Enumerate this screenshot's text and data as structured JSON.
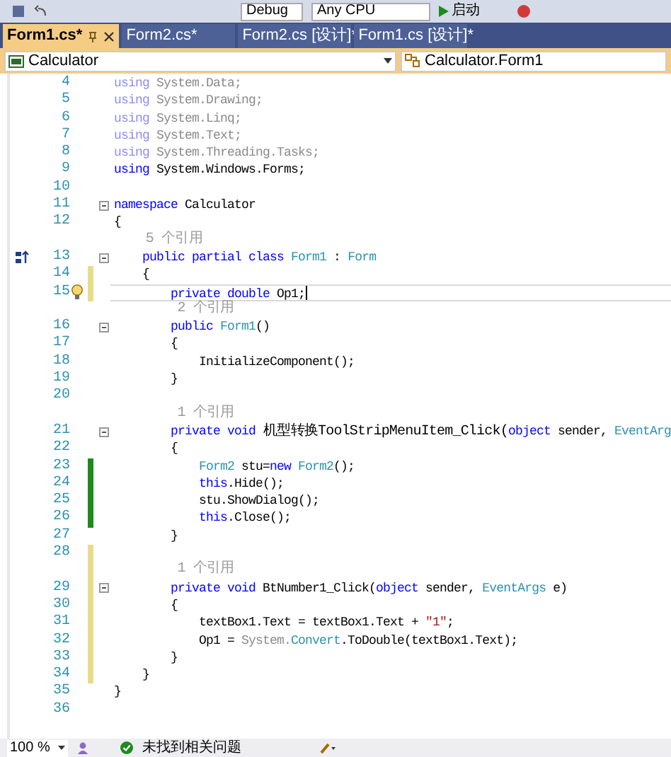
{
  "toolbar": {
    "configuration": "Debug",
    "platform": "Any CPU",
    "start": "启动"
  },
  "tabs": [
    {
      "label": "Form1.cs*",
      "selected": true,
      "pinned": true
    },
    {
      "label": "Form2.cs*",
      "selected": false,
      "pinned": false
    },
    {
      "label": "Form2.cs [设计]*",
      "selected": false,
      "pinned": false
    },
    {
      "label": "Form1.cs [设计]*",
      "selected": false,
      "pinned": false
    }
  ],
  "navigation": {
    "project": "Calculator",
    "type": "Calculator.Form1"
  },
  "rows": [
    {
      "kind": "code",
      "number": "4",
      "current": false,
      "fold": false,
      "tokens": [
        {
          "t": "using",
          "color": "#8c8cf0"
        },
        {
          "t": " System.Data;",
          "color": "#8a8a8a"
        }
      ]
    },
    {
      "kind": "code",
      "number": "5",
      "current": false,
      "fold": false,
      "tokens": [
        {
          "t": "using",
          "color": "#8c8cf0"
        },
        {
          "t": " System.Drawing;",
          "color": "#8a8a8a"
        }
      ]
    },
    {
      "kind": "code",
      "number": "6",
      "current": false,
      "fold": false,
      "tokens": [
        {
          "t": "using",
          "color": "#8c8cf0"
        },
        {
          "t": " System.Linq;",
          "color": "#8a8a8a"
        }
      ]
    },
    {
      "kind": "code",
      "number": "7",
      "current": false,
      "fold": false,
      "tokens": [
        {
          "t": "using",
          "color": "#8c8cf0"
        },
        {
          "t": " System.Text;",
          "color": "#8a8a8a"
        }
      ]
    },
    {
      "kind": "code",
      "number": "8",
      "current": false,
      "fold": false,
      "tokens": [
        {
          "t": "using",
          "color": "#8c8cf0"
        },
        {
          "t": " System.Threading.Tasks;",
          "color": "#8a8a8a"
        }
      ]
    },
    {
      "kind": "code",
      "number": "9",
      "current": false,
      "fold": false,
      "tokens": [
        {
          "t": "using",
          "color": "#0000ff"
        },
        {
          "t": " System.Windows.Forms;",
          "color": "#000000"
        }
      ]
    },
    {
      "kind": "code",
      "number": "10",
      "current": false,
      "fold": false
    },
    {
      "kind": "code",
      "number": "11",
      "current": false,
      "fold": true,
      "tokens": [
        {
          "t": "namespace",
          "color": "#0000ff"
        },
        {
          "t": " Calculator",
          "color": "#000000"
        }
      ]
    },
    {
      "kind": "code",
      "number": "12",
      "current": false,
      "fold": false,
      "tokens": [
        {
          "t": "{",
          "color": "#000000"
        }
      ]
    },
    {
      "kind": "codelens",
      "text": "    5 个引用"
    },
    {
      "kind": "code",
      "number": "13",
      "current": false,
      "fold": true,
      "inheritance": true,
      "tokens": [
        {
          "t": "    public",
          "color": "#0000ff"
        },
        {
          "t": " partial",
          "color": "#0000ff"
        },
        {
          "t": " class",
          "color": "#0000ff"
        },
        {
          "t": " Form1",
          "color": "#2b91af"
        },
        {
          "t": " :",
          "color": "#000000"
        },
        {
          "t": " Form",
          "color": "#2b91af"
        }
      ]
    },
    {
      "kind": "code",
      "number": "14",
      "color": "#e8dc8c",
      "current": false,
      "fold": false,
      "tokens": [
        {
          "t": "    {",
          "color": "#000000"
        }
      ]
    },
    {
      "kind": "code",
      "number": "15",
      "color": "#e8dc8c",
      "current": true,
      "fold": false,
      "lightbulb": true,
      "tokens": [
        {
          "t": "        private",
          "color": "#0000ff"
        },
        {
          "t": " double",
          "color": "#0000ff"
        },
        {
          "t": " Op1;",
          "color": "#000000"
        }
      ]
    },
    {
      "kind": "codelens",
      "text": "        2 个引用"
    },
    {
      "kind": "code",
      "number": "16",
      "current": false,
      "fold": true,
      "tokens": [
        {
          "t": "        public",
          "color": "#0000ff"
        },
        {
          "t": " Form1",
          "color": "#2b91af"
        },
        {
          "t": "()",
          "color": "#000000"
        }
      ]
    },
    {
      "kind": "code",
      "number": "17",
      "current": false,
      "fold": false,
      "tokens": [
        {
          "t": "        {",
          "color": "#000000"
        }
      ]
    },
    {
      "kind": "code",
      "number": "18",
      "current": false,
      "fold": false,
      "tokens": [
        {
          "t": "            InitializeComponent();",
          "color": "#000000"
        }
      ]
    },
    {
      "kind": "code",
      "number": "19",
      "current": false,
      "fold": false,
      "tokens": [
        {
          "t": "        }",
          "color": "#000000"
        }
      ]
    },
    {
      "kind": "code",
      "number": "20",
      "current": false,
      "fold": false
    },
    {
      "kind": "codelens",
      "text": "        1 个引用"
    },
    {
      "kind": "code",
      "number": "21",
      "current": false,
      "fold": true,
      "tokens": [
        {
          "t": "        private",
          "color": "#0000ff"
        },
        {
          "t": " void",
          "color": "#0000ff"
        },
        {
          "t": " 机型转换ToolStripMenuItem_Click(",
          "color": "#000000"
        },
        {
          "t": "object",
          "color": "#0000ff"
        },
        {
          "t": " sender,",
          "color": "#000000"
        },
        {
          "t": " EventArg",
          "color": "#2b91af"
        }
      ]
    },
    {
      "kind": "code",
      "number": "22",
      "current": false,
      "fold": false,
      "tokens": [
        {
          "t": "        {",
          "color": "#000000"
        }
      ]
    },
    {
      "kind": "code",
      "number": "23",
      "color": "#1e8a1e",
      "current": false,
      "fold": false,
      "tokens": [
        {
          "t": "            Form2",
          "color": "#2b91af"
        },
        {
          "t": " stu=",
          "color": "#000000"
        },
        {
          "t": "new",
          "color": "#0000ff"
        },
        {
          "t": " Form2",
          "color": "#2b91af"
        },
        {
          "t": "();",
          "color": "#000000"
        }
      ]
    },
    {
      "kind": "code",
      "number": "24",
      "color": "#1e8a1e",
      "current": false,
      "fold": false,
      "tokens": [
        {
          "t": "            this",
          "color": "#0000ff"
        },
        {
          "t": ".Hide();",
          "color": "#000000"
        }
      ]
    },
    {
      "kind": "code",
      "number": "25",
      "color": "#1e8a1e",
      "current": false,
      "fold": false,
      "tokens": [
        {
          "t": "            stu.ShowDialog();",
          "color": "#000000"
        }
      ]
    },
    {
      "kind": "code",
      "number": "26",
      "color": "#1e8a1e",
      "current": false,
      "fold": false,
      "tokens": [
        {
          "t": "            this",
          "color": "#0000ff"
        },
        {
          "t": ".Close();",
          "color": "#000000"
        }
      ]
    },
    {
      "kind": "code",
      "number": "27",
      "current": false,
      "fold": false,
      "tokens": [
        {
          "t": "        }",
          "color": "#000000"
        }
      ]
    },
    {
      "kind": "code",
      "number": "28",
      "color": "#e8dc8c",
      "current": false,
      "fold": false
    },
    {
      "kind": "codelens",
      "color": "#e8dc8c",
      "text": "        1 个引用"
    },
    {
      "kind": "code",
      "number": "29",
      "color": "#e8dc8c",
      "current": false,
      "fold": true,
      "tokens": [
        {
          "t": "        private",
          "color": "#0000ff"
        },
        {
          "t": " void",
          "color": "#0000ff"
        },
        {
          "t": " BtNumber1_Click(",
          "color": "#000000"
        },
        {
          "t": "object",
          "color": "#0000ff"
        },
        {
          "t": " sender,",
          "color": "#000000"
        },
        {
          "t": " EventArgs",
          "color": "#2b91af"
        },
        {
          "t": " e)",
          "color": "#000000"
        }
      ]
    },
    {
      "kind": "code",
      "number": "30",
      "color": "#e8dc8c",
      "current": false,
      "fold": false,
      "tokens": [
        {
          "t": "        {",
          "color": "#000000"
        }
      ]
    },
    {
      "kind": "code",
      "number": "31",
      "color": "#e8dc8c",
      "current": false,
      "fold": false,
      "tokens": [
        {
          "t": "            textBox1.Text = textBox1.Text + ",
          "color": "#000000"
        },
        {
          "t": "\"1\"",
          "color": "#a31515"
        },
        {
          "t": ";",
          "color": "#000000"
        }
      ]
    },
    {
      "kind": "code",
      "number": "32",
      "color": "#e8dc8c",
      "current": false,
      "fold": false,
      "tokens": [
        {
          "t": "            Op1 = ",
          "color": "#000000"
        },
        {
          "t": "System.",
          "color": "#8a8a8a"
        },
        {
          "t": "Convert",
          "color": "#2b91af"
        },
        {
          "t": ".ToDouble(textBox1.Text);",
          "color": "#000000"
        }
      ]
    },
    {
      "kind": "code",
      "number": "33",
      "color": "#e8dc8c",
      "current": false,
      "fold": false,
      "tokens": [
        {
          "t": "        }",
          "color": "#000000"
        }
      ]
    },
    {
      "kind": "code",
      "number": "34",
      "color": "#e8dc8c",
      "current": false,
      "fold": false,
      "tokens": [
        {
          "t": "    }",
          "color": "#000000"
        }
      ]
    },
    {
      "kind": "code",
      "number": "35",
      "current": false,
      "fold": false,
      "tokens": [
        {
          "t": "}",
          "color": "#000000"
        }
      ]
    },
    {
      "kind": "code",
      "number": "36",
      "current": false,
      "fold": false
    }
  ],
  "status_bar": {
    "zoom": "100 %",
    "issues": "未找到相关问题"
  }
}
